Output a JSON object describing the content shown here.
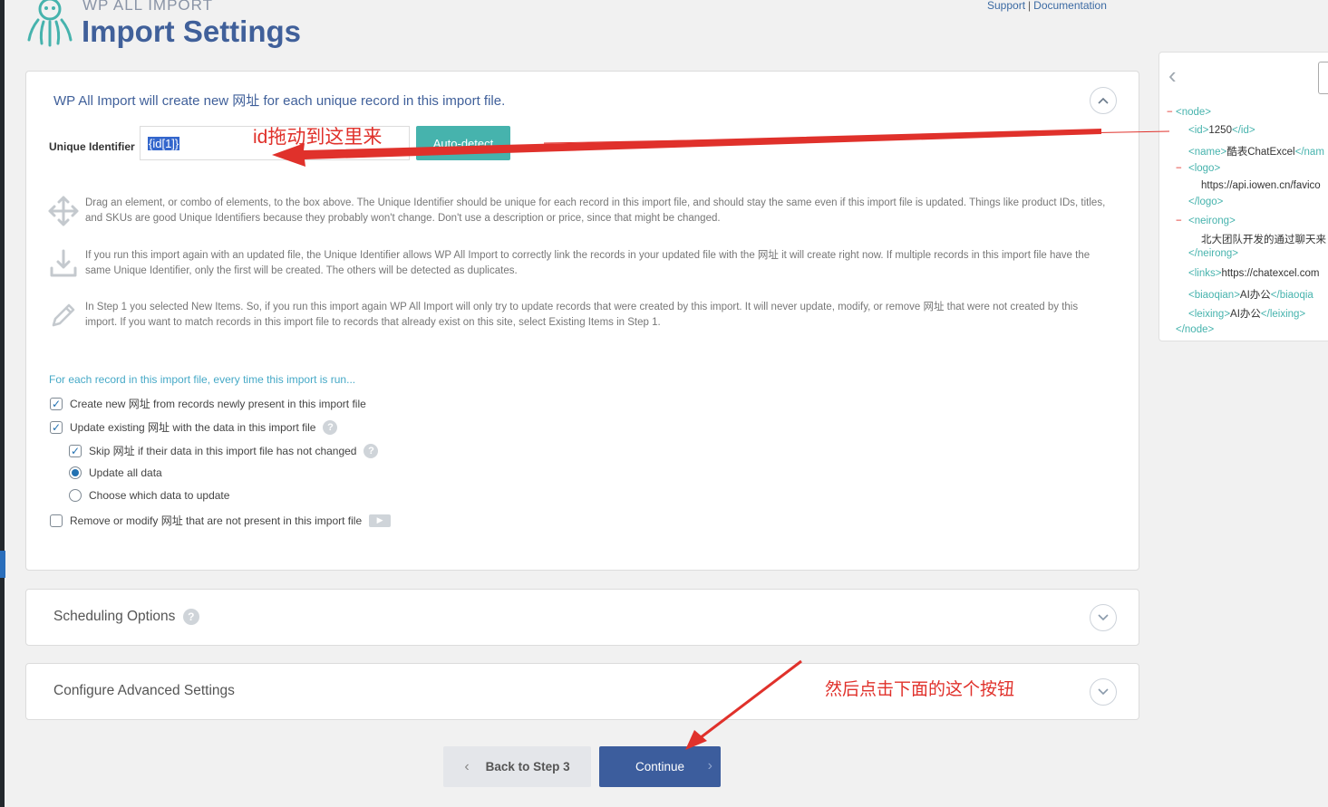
{
  "header": {
    "brand_small": "WP ALL IMPORT",
    "title": "Import Settings",
    "links": {
      "support": "Support",
      "separator": "|",
      "documentation": "Documentation"
    }
  },
  "main_panel": {
    "heading": "WP All Import will create new 网址 for each unique record in this import file.",
    "uid_label": "Unique Identifier",
    "uid_value": "{id[1]}",
    "auto_detect_label": "Auto-detect",
    "info": [
      {
        "icon": "move-arrows-icon",
        "text": "Drag an element, or combo of elements, to the box above. The Unique Identifier should be unique for each record in this import file, and should stay the same even if this import file is updated. Things like product IDs, titles, and SKUs are good Unique Identifiers because they probably won't change. Don't use a description or price, since that might be changed."
      },
      {
        "icon": "download-tray-icon",
        "text": "If you run this import again with an updated file, the Unique Identifier allows WP All Import to correctly link the records in your updated file with the 网址 it will create right now. If multiple records in this import file have the same Unique Identifier, only the first will be created. The others will be detected as duplicates."
      },
      {
        "icon": "pencil-icon",
        "text": "In Step 1 you selected New Items. So, if you run this import again WP All Import will only try to update records that were created by this import. It will never update, modify, or remove 网址 that were not created by this import. If you want to match records in this import file to records that already exist on this site, select Existing Items in Step 1."
      }
    ],
    "each_record_label": "For each record in this import file, every time this import is run...",
    "options": {
      "create_new": {
        "label": "Create new 网址 from records newly present in this import file",
        "checked": true
      },
      "update_existing": {
        "label": "Update existing 网址 with the data in this import file",
        "checked": true
      },
      "skip_unchanged": {
        "label": "Skip 网址 if their data in this import file has not changed",
        "checked": true
      },
      "update_all": {
        "label": "Update all data",
        "selected": true
      },
      "choose_which": {
        "label": "Choose which data to update",
        "selected": false
      },
      "remove_modify": {
        "label": "Remove or modify 网址 that are not present in this import file",
        "checked": false
      }
    }
  },
  "scheduling": {
    "title": "Scheduling Options"
  },
  "advanced": {
    "title": "Configure Advanced Settings"
  },
  "annotations": {
    "drag_hint": "id拖动到这里来",
    "click_hint": "然后点击下面的这个按钮"
  },
  "footer_buttons": {
    "back": "Back to Step 3",
    "continue": "Continue"
  },
  "xml_preview": {
    "lines": [
      {
        "open": "node"
      },
      {
        "tag": "id",
        "value": "1250"
      },
      {
        "tag": "name",
        "value": "酷表ChatExcel",
        "close_prefix": "</nam"
      },
      {
        "open": "logo"
      },
      {
        "text": "https://api.iowen.cn/favico"
      },
      {
        "close": "logo"
      },
      {
        "open": "neirong"
      },
      {
        "text": "北大团队开发的通过聊天来"
      },
      {
        "close": "neirong"
      },
      {
        "tag": "links",
        "value": "https://chatexcel.com"
      },
      {
        "tag": "biaoqian",
        "value": "AI办公",
        "close_prefix": "</biaoqia"
      },
      {
        "tag": "leixing",
        "value": "AI办公"
      },
      {
        "close": "node"
      }
    ],
    "l1": "<node>",
    "l2a": "<id>",
    "l2b": "1250",
    "l2c": "</id>",
    "l3a": "<name>",
    "l3b": "酷表ChatExcel",
    "l3c": "</nam",
    "l4": "<logo>",
    "l5": "https://api.iowen.cn/favico",
    "l6": "</logo>",
    "l7": "<neirong>",
    "l8": "北大团队开发的通过聊天来",
    "l9": "</neirong>",
    "l10a": "<links>",
    "l10b": "https://chatexcel.com",
    "l11a": "<biaoqian>",
    "l11b": "AI办公",
    "l11c": "</biaoqia",
    "l12a": "<leixing>",
    "l12b": "AI办公",
    "l12c": "</leixing>",
    "l13": "</node>"
  },
  "colors": {
    "brand_blue": "#40609a",
    "teal": "#46b3ad",
    "continue_bg": "#3c5d9d",
    "annotation_red": "#e0312b"
  }
}
